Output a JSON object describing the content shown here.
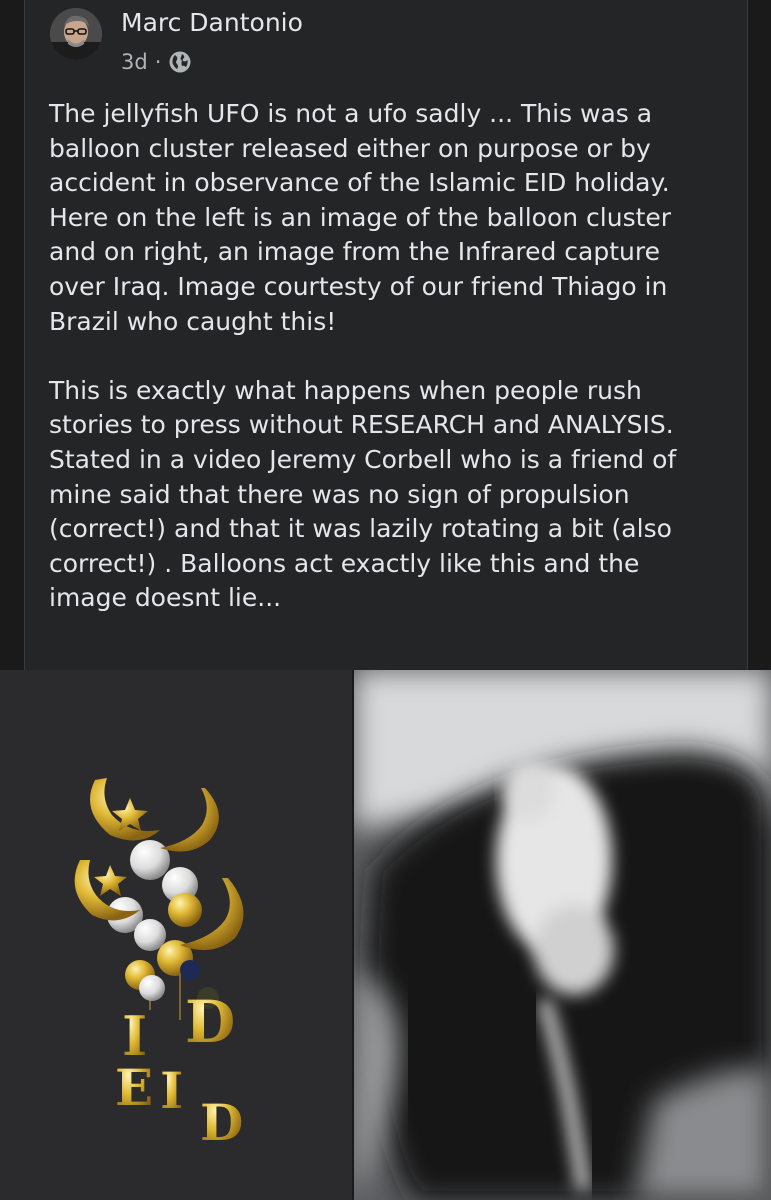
{
  "post": {
    "author": "Marc Dantonio",
    "time": "3d",
    "separator": "·",
    "privacy_icon": "globe-icon",
    "paragraphs": [
      "The jellyfish UFO is not a ufo sadly ... This was a\nballoon cluster  released either on purpose or by\naccident in observance of the Islamic EID holiday.\nHere on the left is an image of the balloon cluster\nand on right, an image from the Infrared capture\nover Iraq. Image courtesty of our friend Thiago in\nBrazil who caught this!",
      "This is exactly what happens when people rush\nstories to press without RESEARCH and ANALYSIS.\nStated in a video Jeremy Corbell who is a friend of\nmine said that there was no sign of propulsion\n(correct!) and that it was lazily rotating a bit (also\ncorrect!) . Balloons act exactly like this and the\nimage doesnt lie..."
    ]
  },
  "images": {
    "left_letters": [
      "E",
      "I",
      "D"
    ]
  },
  "colors": {
    "background": "#1a1a1a",
    "card": "#242526",
    "text": "#e4e6eb",
    "secondary_text": "#b0b3b8",
    "gold": "#d9b230"
  }
}
